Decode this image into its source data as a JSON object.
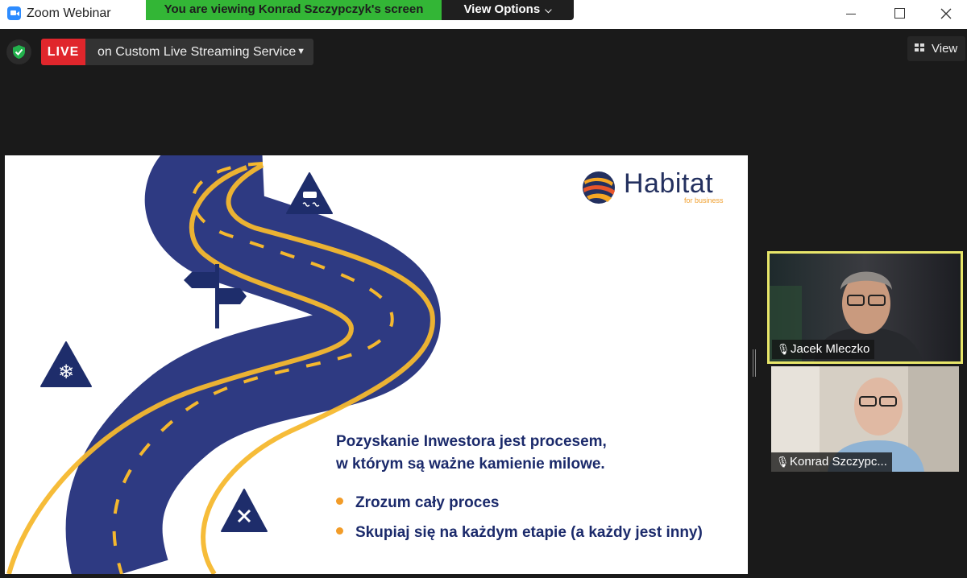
{
  "window": {
    "title": "Zoom Webinar",
    "viewing_banner": "You are viewing Konrad Szczypczyk's screen",
    "view_options_label": "View Options"
  },
  "live_bar": {
    "live_label": "LIVE",
    "service_label": "on Custom Live Streaming Service",
    "view_label": "View"
  },
  "slide": {
    "logo_name": "Habitat",
    "logo_subtitle": "for business",
    "heading_line1": "Pozyskanie Inwestora jest procesem,",
    "heading_line2": "w którym są ważne kamienie milowe.",
    "bullets": [
      "Zrozum cały proces",
      "Skupiaj się na każdym etapie (a każdy jest inny)"
    ],
    "colors": {
      "road": "#2e3a82",
      "road_edge": "#f5b82e",
      "heading_text": "#1b2a6b",
      "bullet_dot": "#f29c28",
      "sign": "#1e2d6b"
    },
    "icons": [
      "slippery-road-sign-icon",
      "signpost-icon",
      "snow-warning-sign-icon",
      "cross-warning-sign-icon"
    ]
  },
  "participants": [
    {
      "name": "Jacek Mleczko",
      "active_speaker": true
    },
    {
      "name": "Konrad Szczypc..."
    }
  ],
  "colors": {
    "viewing_banner": "#33b636",
    "live_badge": "#e0262c",
    "active_speaker_border": "#e8e66a",
    "background": "#1a1a1a"
  }
}
